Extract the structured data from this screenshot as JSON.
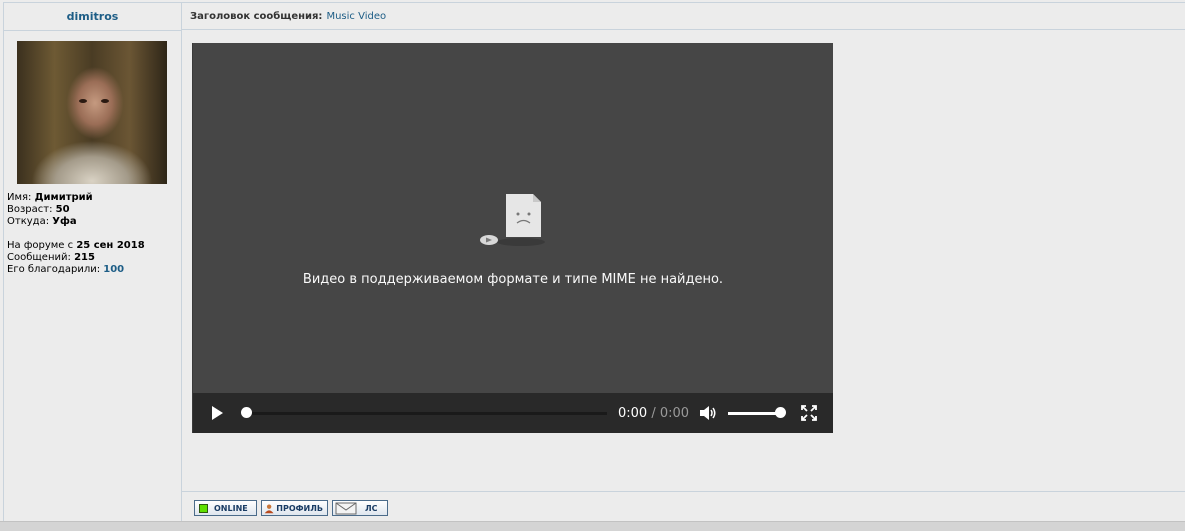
{
  "post": {
    "author": "dimitros",
    "subject_label": "Заголовок сообщения:",
    "subject_value": "Music Video"
  },
  "profile": {
    "name_label": "Имя:",
    "name_value": "Димитрий",
    "age_label": "Возраст:",
    "age_value": "50",
    "from_label": "Откуда:",
    "from_value": "Уфа",
    "since_label": "На форуме с",
    "since_value": "25 сен 2018",
    "posts_label": "Сообщений:",
    "posts_value": "215",
    "thanks_label": "Его благодарили:",
    "thanks_value": "100"
  },
  "player": {
    "error_text": "Видео в поддерживаемом формате и типе MIME не найдено.",
    "current_time": "0:00",
    "separator": "/",
    "duration": "0:00",
    "progress": 0,
    "volume": 1.0
  },
  "footer_buttons": {
    "online": "ONLINE",
    "profile": "ПРОФИЛЬ",
    "pm": "ЛС"
  },
  "icons": [
    "sad-file-icon",
    "play-icon",
    "volume-icon",
    "fullscreen-icon",
    "person-icon",
    "envelope-icon"
  ],
  "colors": {
    "link": "#1d5d86",
    "player_bg": "#464646",
    "controls_bg": "#292929",
    "online": "#5fe000"
  }
}
